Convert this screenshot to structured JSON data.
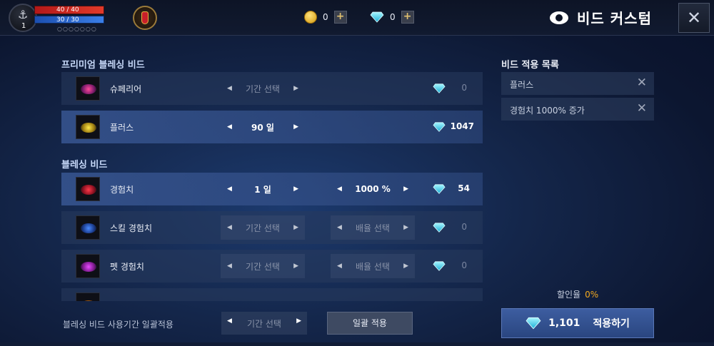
{
  "topbar": {
    "level": "1",
    "hp": "40 / 40",
    "mp": "30 / 30",
    "gold": "0",
    "gems": "0",
    "plus": "+",
    "title": "비드 커스텀",
    "close": "✕"
  },
  "premium": {
    "header": "프리미엄 블레싱 비드",
    "rows": [
      {
        "name": "슈페리어",
        "period": "기간 선택",
        "price": "0"
      },
      {
        "name": "플러스",
        "period": "90 일",
        "price": "1047"
      }
    ]
  },
  "blessing": {
    "header": "블레싱 비드",
    "rows": [
      {
        "name": "경험치",
        "period": "1 일",
        "rate": "1000 %",
        "price": "54"
      },
      {
        "name": "스킬 경험치",
        "period": "기간 선택",
        "rate": "배율 선택",
        "price": "0"
      },
      {
        "name": "펫 경험치",
        "period": "기간 선택",
        "rate": "배율 선택",
        "price": "0"
      }
    ]
  },
  "arrows": {
    "left": "◀",
    "right": "▶"
  },
  "applied": {
    "header": "비드 적용 목록",
    "items": [
      "플러스",
      "경험치 1000% 증가"
    ],
    "remove": "✕"
  },
  "discount": {
    "label": "할인율",
    "value": "0%"
  },
  "apply": {
    "total": "1,101",
    "label": "적용하기"
  },
  "bulk": {
    "label": "블레싱 비드 사용기간 일괄적용",
    "period": "기간 선택",
    "button": "일괄 적용"
  },
  "colors": {
    "accent": "#2a4680",
    "gem": "#3fd6f0",
    "discount": "#f2a81e",
    "hp": "#d02a22",
    "mp": "#2d6ad8"
  },
  "icons": {
    "gem": "gem-icon",
    "coin": "coin-icon",
    "close": "close-icon",
    "eye": "eye-icon"
  }
}
